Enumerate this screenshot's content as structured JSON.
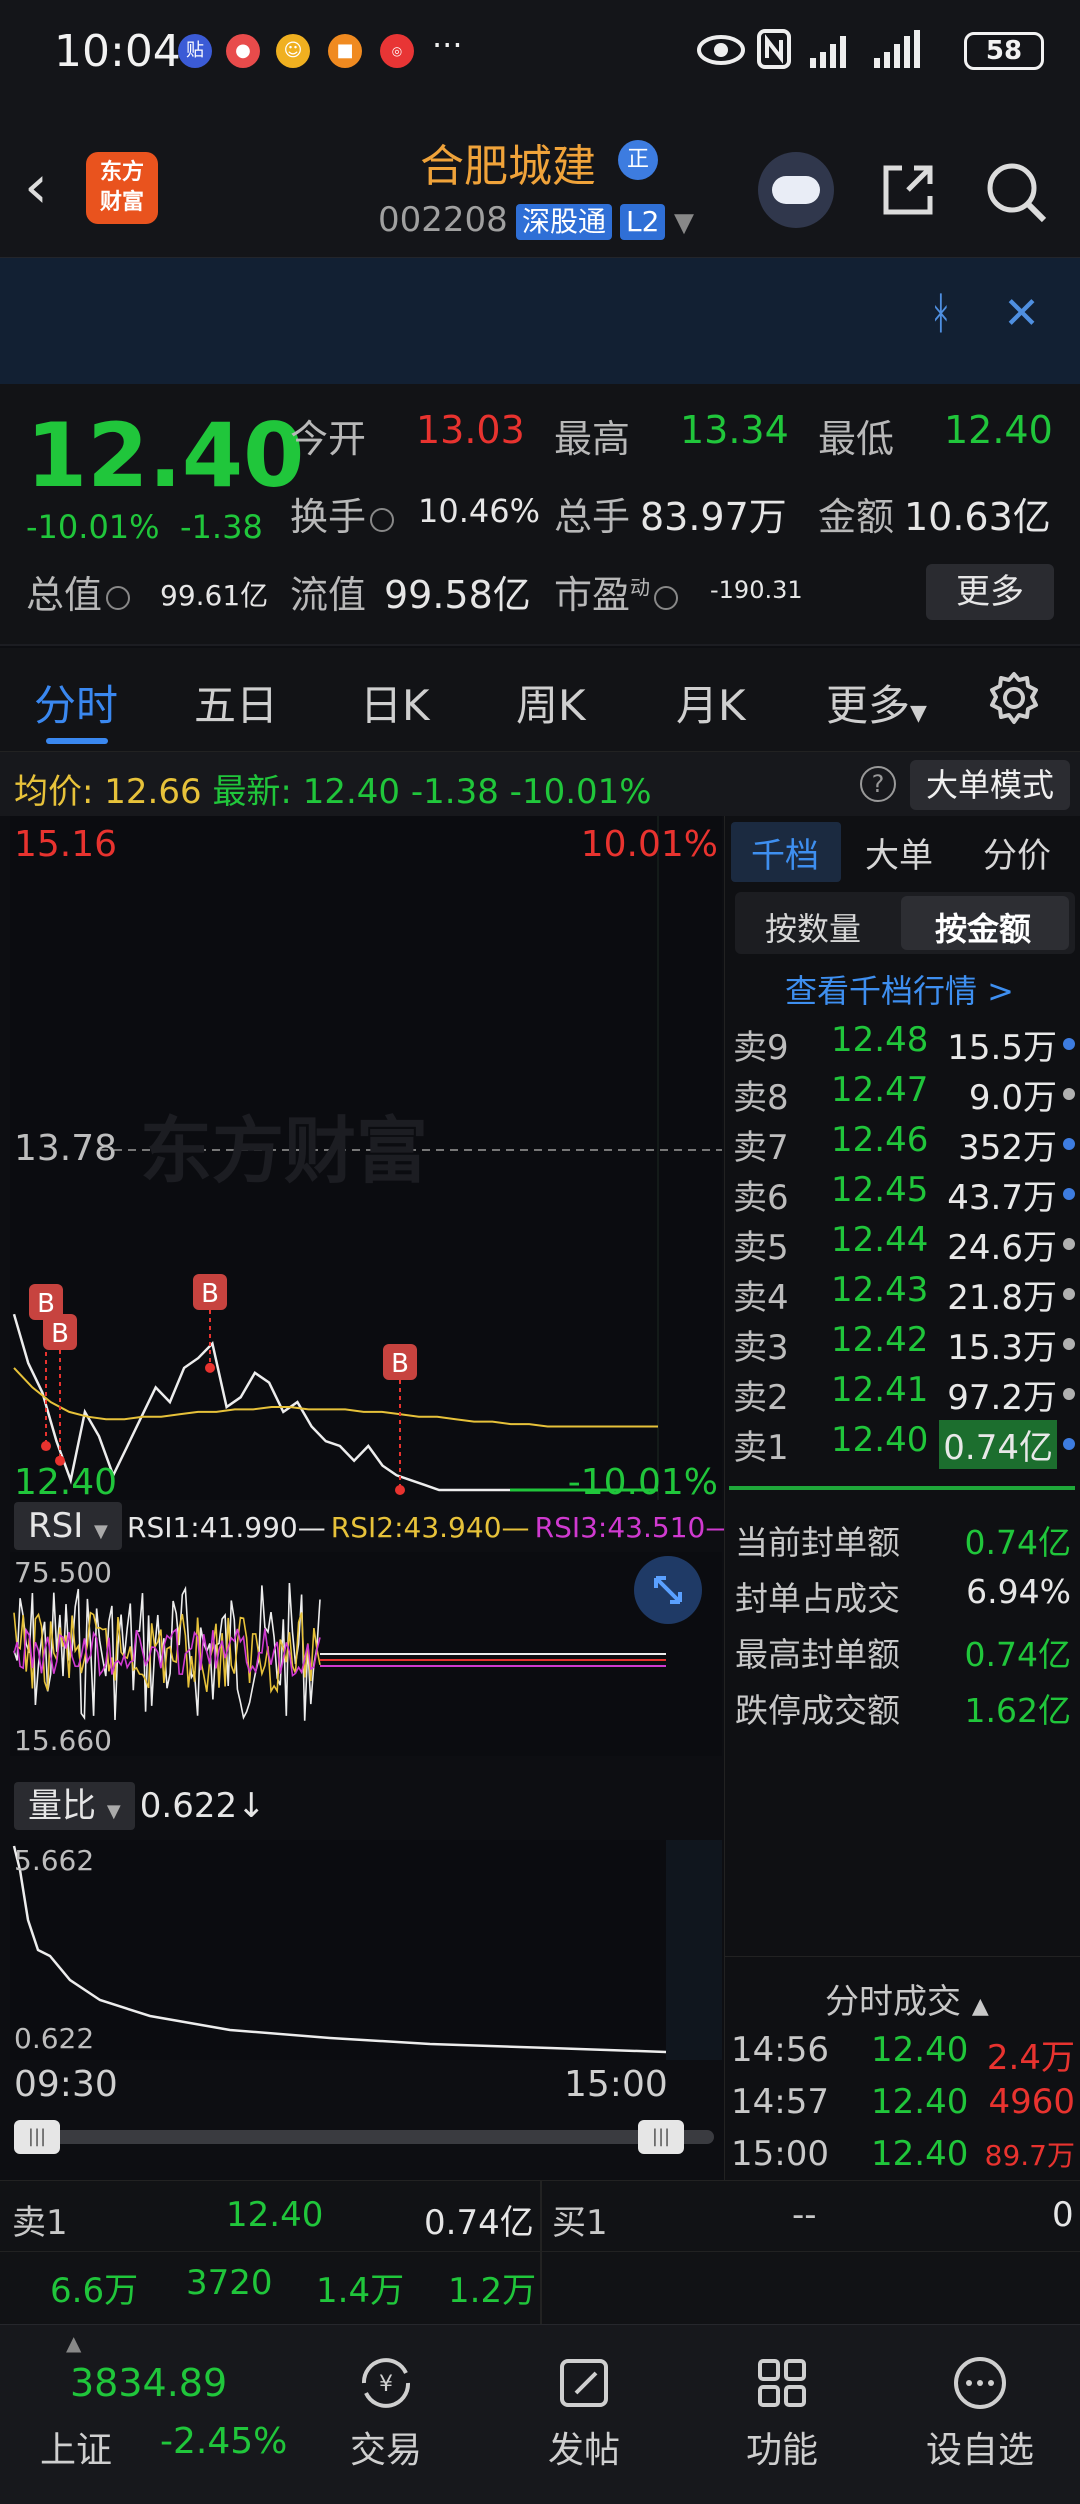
{
  "status_bar": {
    "time": "10:04",
    "icons": [
      "tieba-icon",
      "notify-icon",
      "app-icon",
      "shop-icon",
      "redbadge-icon",
      "more-dots"
    ],
    "battery": "58"
  },
  "header": {
    "logo_line1": "东方",
    "logo_line2": "财富",
    "stock_name": "合肥城建",
    "badge": "正",
    "code": "002208",
    "market_badge": "深股通",
    "level_badge": "L2"
  },
  "quote": {
    "price": "12.40",
    "change_pct": "-10.01%",
    "change": "-1.38",
    "fields": {
      "open_label": "今开",
      "open": "13.03",
      "high_label": "最高",
      "high": "13.34",
      "low_label": "最低",
      "low": "12.40",
      "turnover_label": "换手",
      "turnover": "10.46%",
      "volume_label": "总手",
      "volume": "83.97万",
      "amount_label": "金额",
      "amount": "10.63亿",
      "mktcap_label": "总值",
      "mktcap": "99.61亿",
      "float_label": "流值",
      "float": "99.58亿",
      "pe_label": "市盈",
      "pe_sup": "动",
      "pe": "-190.31"
    },
    "more_button": "更多"
  },
  "tabs": [
    "分时",
    "五日",
    "日K",
    "周K",
    "月K",
    "更多"
  ],
  "avg_bar": {
    "avg_label": "均价:",
    "avg": "12.66",
    "latest_label": "最新:",
    "latest": "12.40",
    "change": "-1.38",
    "change_pct": "-10.01%",
    "big_order_button": "大单模式"
  },
  "chart": {
    "y_top": "15.16",
    "y_top_pct": "10.01%",
    "y_mid": "13.78",
    "y_bottom": "12.40",
    "y_bottom_pct": "-10.01%",
    "watermark": "东方财富",
    "marker": "B",
    "rsi": {
      "button": "RSI",
      "rsi1": "RSI1:41.990",
      "rsi2": "RSI2:43.940",
      "rsi3": "RSI3:43.510",
      "ymax": "75.500",
      "ymin": "15.660"
    },
    "volume_ratio": {
      "button": "量比",
      "value": "0.622↓",
      "ymax": "5.662",
      "ymin": "0.622"
    },
    "time_start": "09:30",
    "time_end": "15:00"
  },
  "chart_data": {
    "type": "line",
    "title": "",
    "xlabel": "",
    "ylabel": "",
    "x_range": [
      "09:30",
      "15:00"
    ],
    "ylim": [
      12.4,
      15.16
    ],
    "reference_price": 13.78,
    "series": [
      {
        "values": [
          13.12,
          12.92,
          12.8,
          12.6,
          12.44,
          12.72,
          12.62,
          12.46,
          12.58,
          12.7,
          12.82,
          12.76,
          12.9,
          12.94,
          13.0,
          12.74,
          12.78,
          12.88,
          12.84,
          12.72,
          12.76,
          12.66,
          12.6,
          12.58,
          12.52,
          12.58,
          12.5,
          12.46,
          12.44,
          12.42,
          12.4,
          12.4,
          12.4,
          12.4,
          12.4,
          12.4
        ]
      },
      {
        "values": [
          12.9,
          12.82,
          12.76,
          12.72,
          12.7,
          12.69,
          12.69,
          12.7,
          12.7,
          12.71,
          12.72,
          12.72,
          12.73,
          12.73,
          12.74,
          12.74,
          12.73,
          12.73,
          12.73,
          12.72,
          12.72,
          12.71,
          12.7,
          12.7,
          12.69,
          12.68,
          12.68,
          12.67,
          12.67,
          12.66,
          12.66,
          12.66,
          12.66,
          12.66,
          12.66,
          12.66
        ]
      }
    ]
  },
  "right_panel": {
    "tabs": [
      "千档",
      "大单",
      "分价"
    ],
    "mode_buttons": [
      "按数量",
      "按金额"
    ],
    "view_levels": "查看千档行情 >",
    "asks": [
      {
        "label": "卖9",
        "price": "12.48",
        "vol": "15.5万",
        "dot": "#3d7ce0"
      },
      {
        "label": "卖8",
        "price": "12.47",
        "vol": "9.0万",
        "dot": "#b0b0b0"
      },
      {
        "label": "卖7",
        "price": "12.46",
        "vol": "352万",
        "dot": "#3d7ce0"
      },
      {
        "label": "卖6",
        "price": "12.45",
        "vol": "43.7万",
        "dot": "#3d7ce0"
      },
      {
        "label": "卖5",
        "price": "12.44",
        "vol": "24.6万",
        "dot": "#b0b0b0"
      },
      {
        "label": "卖4",
        "price": "12.43",
        "vol": "21.8万",
        "dot": "#b0b0b0"
      },
      {
        "label": "卖3",
        "price": "12.42",
        "vol": "15.3万",
        "dot": "#b0b0b0"
      },
      {
        "label": "卖2",
        "price": "12.41",
        "vol": "97.2万",
        "dot": "#b0b0b0"
      },
      {
        "label": "卖1",
        "price": "12.40",
        "vol": "0.74亿",
        "dot": "#3d7ce0"
      }
    ],
    "seal": [
      {
        "label": "当前封单额",
        "value": "0.74亿",
        "color": "#20c63b"
      },
      {
        "label": "封单占成交",
        "value": "6.94%",
        "color": "#e6e6e6"
      },
      {
        "label": "最高封单额",
        "value": "0.74亿",
        "color": "#20c63b"
      },
      {
        "label": "跌停成交额",
        "value": "1.62亿",
        "color": "#20c63b"
      }
    ],
    "ticks_title": "分时成交",
    "ticks": [
      {
        "time": "14:56",
        "price": "12.40",
        "vol": "2.4万"
      },
      {
        "time": "14:57",
        "price": "12.40",
        "vol": "4960"
      },
      {
        "time": "15:00",
        "price": "12.40",
        "vol": "89.7万"
      }
    ]
  },
  "book": {
    "ask_label": "卖1",
    "ask_price": "12.40",
    "ask_amount": "0.74亿",
    "bid_label": "买1",
    "bid_price": "--",
    "bid_amount": "0",
    "queue": [
      "6.6万",
      "3720",
      "1.4万",
      "1.2万"
    ]
  },
  "bottom_nav": {
    "index_value": "3834.89",
    "index_name": "上证",
    "index_change": "-2.45%",
    "items": [
      "交易",
      "发帖",
      "功能",
      "设自选"
    ]
  }
}
